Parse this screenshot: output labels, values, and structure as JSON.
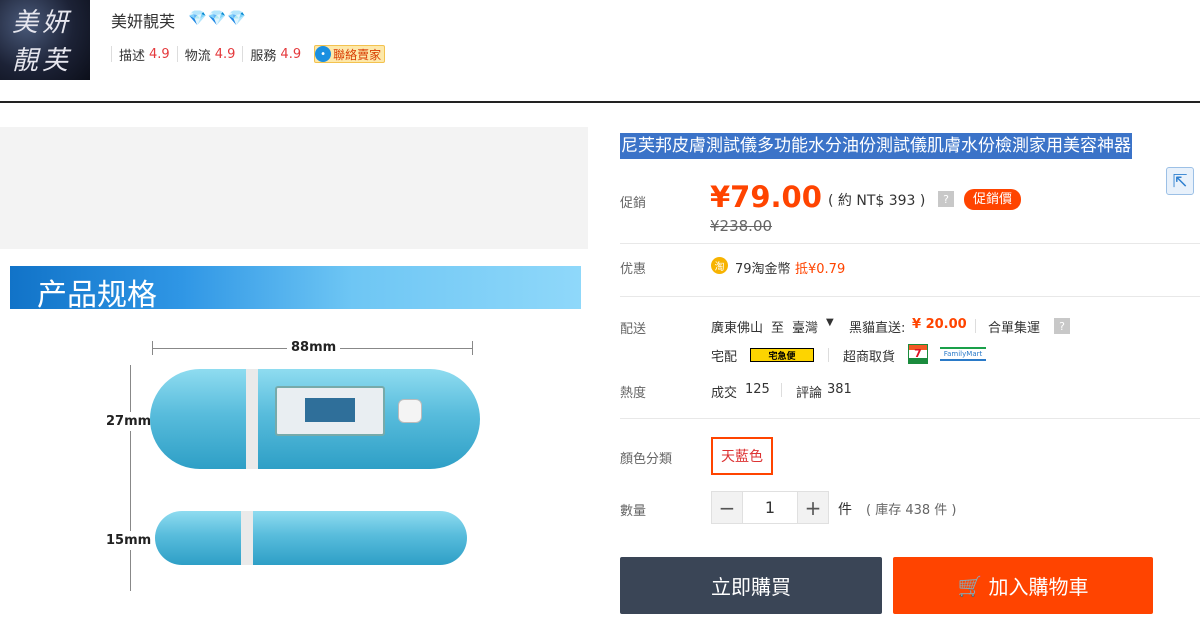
{
  "shop": {
    "logo_text_top": "美妍",
    "logo_text_bottom": "靚芙",
    "name": "美妍靚芙",
    "diamonds": [
      "💎",
      "💎",
      "💎"
    ],
    "ratings": [
      {
        "label": "描述",
        "value": "4.9"
      },
      {
        "label": "物流",
        "value": "4.9"
      },
      {
        "label": "服務",
        "value": "4.9"
      }
    ],
    "contact_label": "聯絡賣家"
  },
  "gallery": {
    "spec_title": "产品规格",
    "length_label": "88mm",
    "height_label": "27mm",
    "thickness_label": "15mm"
  },
  "product": {
    "title": "尼芙邦皮膚測試儀多功能水分油份測試儀肌膚水份檢測家用美容神器",
    "promo_label": "促銷",
    "price": "¥79.00",
    "price_approx": "( 約 NT$ 393 )",
    "promo_badge": "促銷價",
    "original_price": "¥238.00",
    "discount_label": "优惠",
    "coin_text": "79淘金幣",
    "coin_deduct": "抵¥0.79",
    "shipping_label": "配送",
    "ship_from": "廣東佛山",
    "ship_to_word": "至",
    "ship_to": "臺灣",
    "ship_method": "黑貓直送:",
    "ship_fee": "¥ 20.00",
    "ship_consolidate": "合單集運",
    "home_delivery": "宅配",
    "cat_logo": "宅急便",
    "store_pickup": "超商取貨",
    "seven_mark": "7",
    "fm_logo": "FamilyMart",
    "popularity_label": "熱度",
    "deals_label": "成交",
    "deals_value": "125",
    "reviews_label": "評論",
    "reviews_value": "381",
    "color_label": "顏色分類",
    "color_option": "天藍色",
    "qty_label": "數量",
    "qty_minus": "−",
    "qty_value": "1",
    "qty_plus": "+",
    "qty_unit": "件",
    "stock": "( 庫存 438 件 )",
    "buy_now": "立即購買",
    "add_to_cart": "加入購物車",
    "help_mark": "?"
  },
  "colors": {
    "accent": "#ff4400",
    "title_highlight": "#3b73c8",
    "buy_button": "#3a4556"
  },
  "icons": {
    "share": "share-out-icon",
    "cart": "shopping-cart-icon",
    "coin": "taobao-coin-icon",
    "contact": "chat-bubble-icon"
  }
}
